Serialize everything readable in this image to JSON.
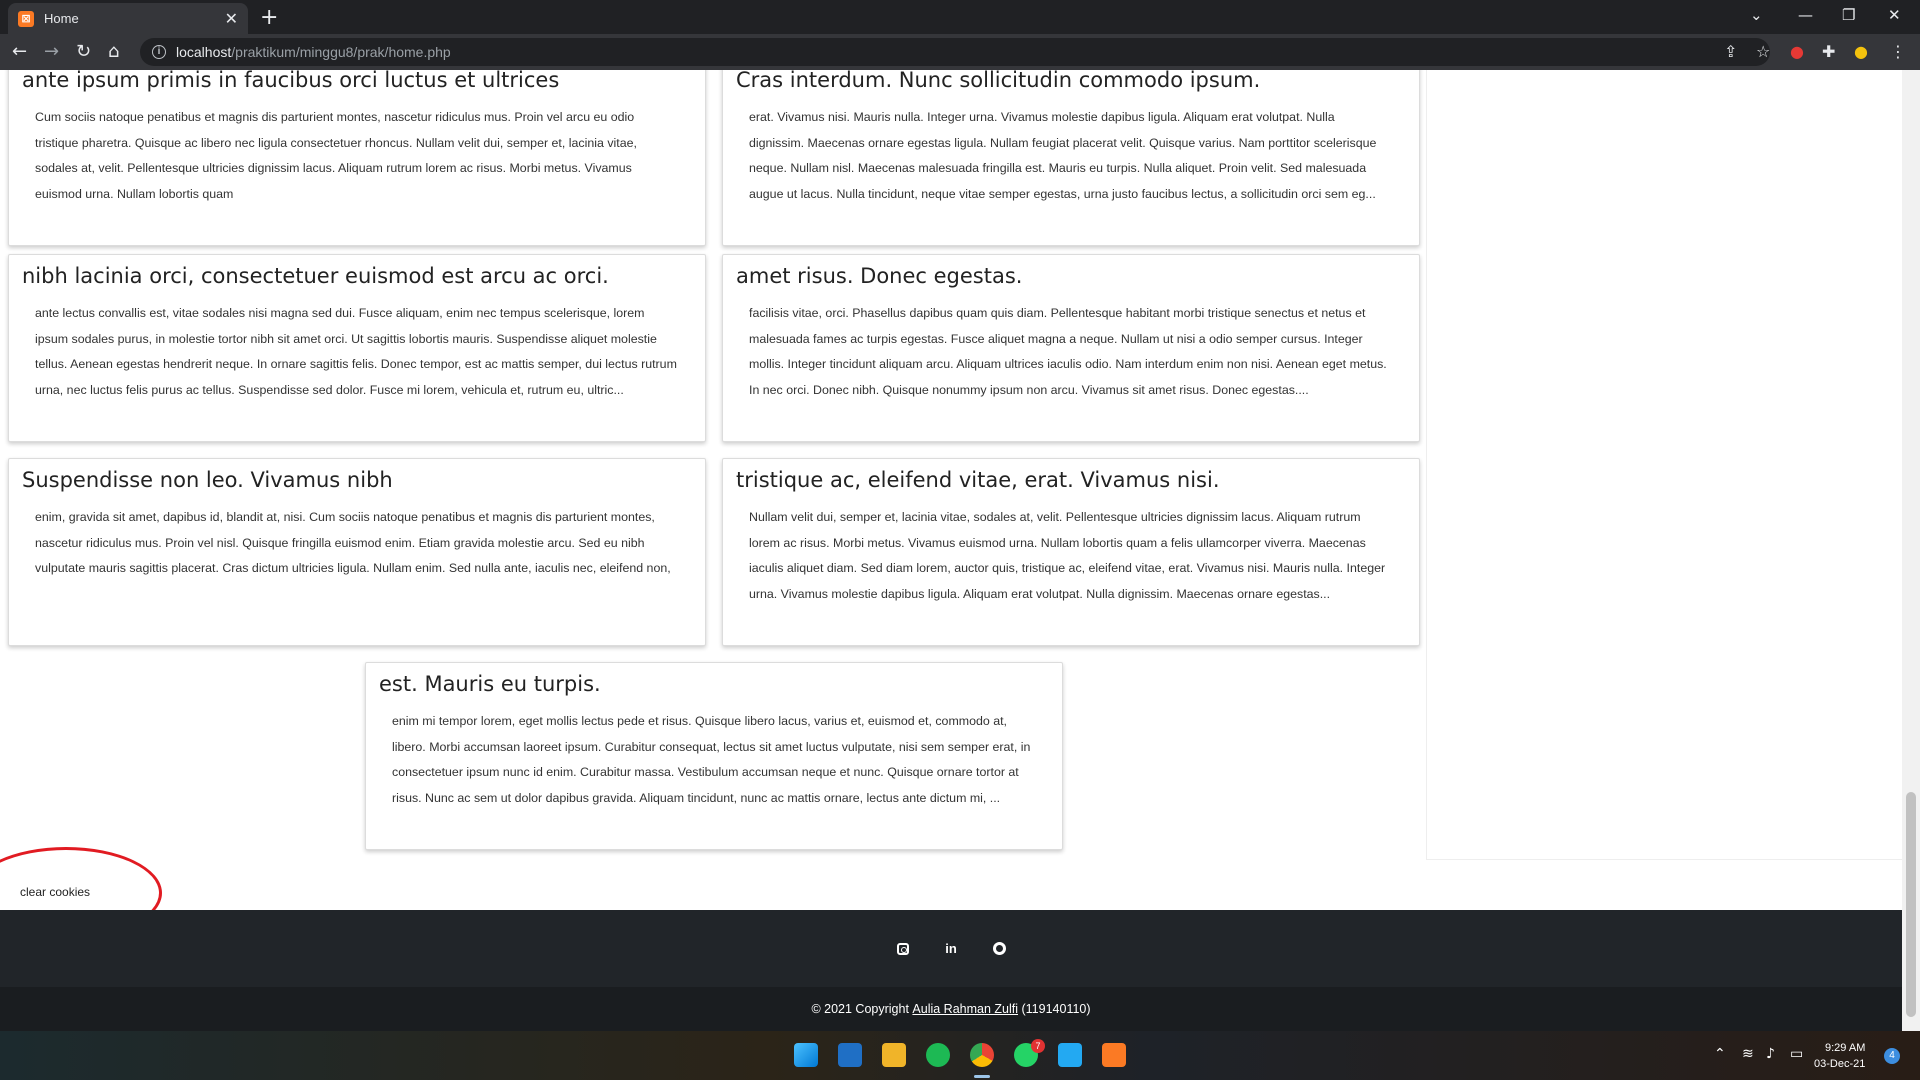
{
  "browser": {
    "tab_title": "Home",
    "url_host": "localhost",
    "url_path": "/praktikum/minggu8/prak/home.php"
  },
  "cards": [
    {
      "title": "ante ipsum primis in faucibus orci luctus et ultrices",
      "text": "Cum sociis natoque penatibus et magnis dis parturient montes, nascetur ridiculus mus. Proin vel arcu eu odio tristique pharetra. Quisque ac libero nec ligula consectetuer rhoncus. Nullam velit dui, semper et, lacinia vitae, sodales at, velit. Pellentesque ultricies dignissim lacus. Aliquam rutrum lorem ac risus. Morbi metus. Vivamus euismod urna. Nullam lobortis quam"
    },
    {
      "title": "Cras interdum. Nunc sollicitudin commodo ipsum.",
      "text": "erat. Vivamus nisi. Mauris nulla. Integer urna. Vivamus molestie dapibus ligula. Aliquam erat volutpat. Nulla dignissim. Maecenas ornare egestas ligula. Nullam feugiat placerat velit. Quisque varius. Nam porttitor scelerisque neque. Nullam nisl. Maecenas malesuada fringilla est. Mauris eu turpis. Nulla aliquet. Proin velit. Sed malesuada augue ut lacus. Nulla tincidunt, neque vitae semper egestas, urna justo faucibus lectus, a sollicitudin orci sem eg..."
    },
    {
      "title": "nibh lacinia orci, consectetuer euismod est arcu ac orci.",
      "text": "ante lectus convallis est, vitae sodales nisi magna sed dui. Fusce aliquam, enim nec tempus scelerisque, lorem ipsum sodales purus, in molestie tortor nibh sit amet orci. Ut sagittis lobortis mauris. Suspendisse aliquet molestie tellus. Aenean egestas hendrerit neque. In ornare sagittis felis. Donec tempor, est ac mattis semper, dui lectus rutrum urna, nec luctus felis purus ac tellus. Suspendisse sed dolor. Fusce mi lorem, vehicula et, rutrum eu, ultric..."
    },
    {
      "title": "amet risus. Donec egestas.",
      "text": "facilisis vitae, orci. Phasellus dapibus quam quis diam. Pellentesque habitant morbi tristique senectus et netus et malesuada fames ac turpis egestas. Fusce aliquet magna a neque. Nullam ut nisi a odio semper cursus. Integer mollis. Integer tincidunt aliquam arcu. Aliquam ultrices iaculis odio. Nam interdum enim non nisi. Aenean eget metus. In nec orci. Donec nibh. Quisque nonummy ipsum non arcu. Vivamus sit amet risus. Donec egestas...."
    },
    {
      "title": "Suspendisse non leo. Vivamus nibh",
      "text": "enim, gravida sit amet, dapibus id, blandit at, nisi. Cum sociis natoque penatibus et magnis dis parturient montes, nascetur ridiculus mus. Proin vel nisl. Quisque fringilla euismod enim. Etiam gravida molestie arcu. Sed eu nibh vulputate mauris sagittis placerat. Cras dictum ultricies ligula. Nullam enim. Sed nulla ante, iaculis nec, eleifend non,"
    },
    {
      "title": "tristique ac, eleifend vitae, erat. Vivamus nisi.",
      "text": "Nullam velit dui, semper et, lacinia vitae, sodales at, velit. Pellentesque ultricies dignissim lacus. Aliquam rutrum lorem ac risus. Morbi metus. Vivamus euismod urna. Nullam lobortis quam a felis ullamcorper viverra. Maecenas iaculis aliquet diam. Sed diam lorem, auctor quis, tristique ac, eleifend vitae, erat. Vivamus nisi. Mauris nulla. Integer urna. Vivamus molestie dapibus ligula. Aliquam erat volutpat. Nulla dignissim. Maecenas ornare egestas..."
    },
    {
      "title": "est. Mauris eu turpis.",
      "text": "enim mi tempor lorem, eget mollis lectus pede et risus. Quisque libero lacus, varius et, euismod et, commodo at, libero. Morbi accumsan laoreet ipsum. Curabitur consequat, lectus sit amet luctus vulputate, nisi sem semper erat, in consectetuer ipsum nunc id enim. Curabitur massa. Vestibulum accumsan neque et nunc. Quisque ornare tortor at risus. Nunc ac sem ut dolor dapibus gravida. Aliquam tincidunt, nunc ac mattis ornare, lectus ante dictum mi, ..."
    }
  ],
  "clear_cookies": "clear cookies",
  "footer": {
    "copyright_prefix": "© 2021 Copyright",
    "author": "Aulia Rahman Zulfi",
    "nim": "(119140110)",
    "social_icons": [
      "instagram-icon",
      "linkedin-icon",
      "github-icon"
    ],
    "linkedin_glyph": "in"
  },
  "taskbar": {
    "time": "9:29 AM",
    "date": "03-Dec-21",
    "notification_count": "4",
    "whatsapp_badge": "7"
  },
  "colors": {
    "annotation_circle": "#e11b22",
    "footer_dark": "#212529",
    "footer_darker": "#1a1d20"
  }
}
